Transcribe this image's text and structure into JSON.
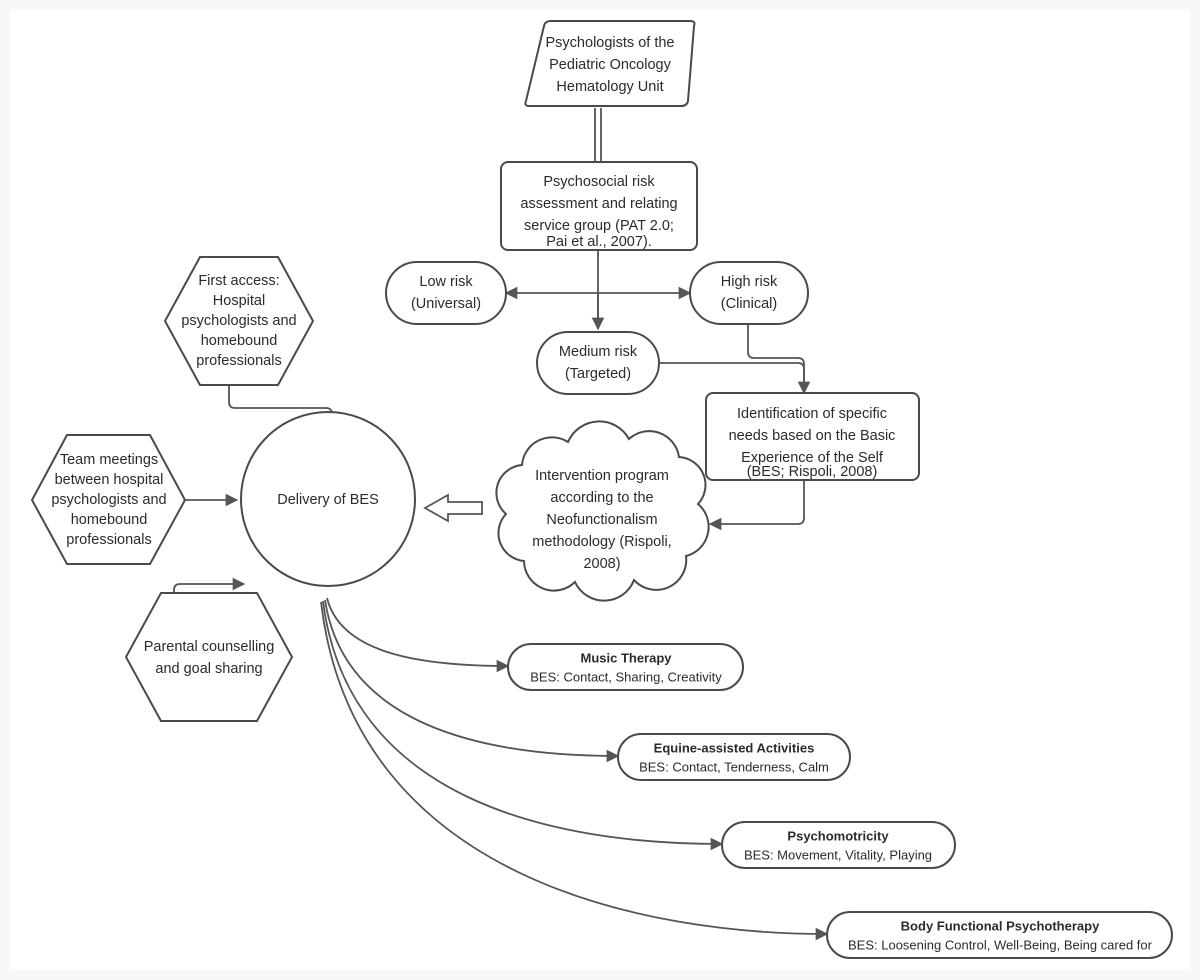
{
  "diagram": {
    "title": "Psychological intervention flow for Pediatric Oncology Hematology Unit",
    "background_color": "#f7f8fa",
    "canvas_color": "#ffffff",
    "stroke_color": "#4a4a4a",
    "edge_color": "#555555"
  },
  "nodes": {
    "source": {
      "shape": "lean-right-parallelogram",
      "lines": [
        "Psychologists of the",
        "Pediatric Oncology",
        "Hematology Unit"
      ]
    },
    "assessment": {
      "shape": "rounded-rectangle",
      "lines": [
        "Psychosocial risk",
        "assessment and relating",
        "service group (PAT 2.0;",
        "Pai et al., 2007)."
      ]
    },
    "low_risk": {
      "shape": "stadium",
      "color": "#b7e1cd",
      "lines": [
        "Low risk",
        "(Universal)"
      ]
    },
    "medium_risk": {
      "shape": "stadium",
      "color": "#e8e23c",
      "lines": [
        "Medium risk",
        "(Targeted)"
      ]
    },
    "high_risk": {
      "shape": "stadium",
      "color": "#f4a48c",
      "lines": [
        "High risk",
        "(Clinical)"
      ]
    },
    "identification": {
      "shape": "rounded-rectangle",
      "lines": [
        "Identification of specific",
        "needs based on the Basic",
        "Experience of the Self",
        "(BES; Rispoli, 2008)"
      ]
    },
    "intervention": {
      "shape": "cloud",
      "lines": [
        "Intervention program",
        "according to the",
        "Neofunctionalism",
        "methodology (Rispoli,",
        "2008)"
      ]
    },
    "delivery": {
      "shape": "circle",
      "lines": [
        "Delivery of BES"
      ]
    },
    "first_access": {
      "shape": "hexagon",
      "lines": [
        "First access:",
        "Hospital",
        "psychologists and",
        "homebound",
        "professionals"
      ]
    },
    "team_meetings": {
      "shape": "hexagon",
      "lines": [
        "Team meetings",
        "between hospital",
        "psychologists and",
        "homebound",
        "professionals"
      ]
    },
    "parental": {
      "shape": "hexagon",
      "lines": [
        "Parental counselling",
        "and goal sharing"
      ]
    }
  },
  "therapies": [
    {
      "id": "music-therapy",
      "title": "Music Therapy",
      "subtitle": "BES: Contact, Sharing, Creativity"
    },
    {
      "id": "equine-assisted-activities",
      "title": "Equine-assisted Activities",
      "subtitle": "BES: Contact, Tenderness, Calm"
    },
    {
      "id": "psychomotricity",
      "title": "Psychomotricity",
      "subtitle": "BES: Movement, Vitality, Playing"
    },
    {
      "id": "body-functional-psychotherapy",
      "title": "Body Functional Psychotherapy",
      "subtitle": "BES: Loosening Control, Well-Being, Being cared for"
    }
  ],
  "chart_data": {
    "type": "diagram",
    "title": "Psychological intervention flow for Pediatric Oncology Hematology Unit",
    "edges": [
      {
        "from": "source",
        "to": "assessment",
        "style": "double-line"
      },
      {
        "from": "assessment",
        "to": "low_risk",
        "style": "arrow"
      },
      {
        "from": "assessment",
        "to": "medium_risk",
        "style": "arrow"
      },
      {
        "from": "assessment",
        "to": "high_risk",
        "style": "arrow"
      },
      {
        "from": "high_risk",
        "to": "identification",
        "style": "arrow"
      },
      {
        "from": "medium_risk",
        "to": "identification",
        "style": "arrow"
      },
      {
        "from": "identification",
        "to": "intervention",
        "style": "arrow"
      },
      {
        "from": "intervention",
        "to": "delivery",
        "style": "thick-hollow-arrow"
      },
      {
        "from": "first_access",
        "to": "delivery",
        "style": "arrow"
      },
      {
        "from": "team_meetings",
        "to": "delivery",
        "style": "arrow"
      },
      {
        "from": "parental",
        "to": "delivery",
        "style": "arrow"
      },
      {
        "from": "delivery",
        "to": "music-therapy",
        "style": "curved-arrow"
      },
      {
        "from": "delivery",
        "to": "equine-assisted-activities",
        "style": "curved-arrow"
      },
      {
        "from": "delivery",
        "to": "psychomotricity",
        "style": "curved-arrow"
      },
      {
        "from": "delivery",
        "to": "body-functional-psychotherapy",
        "style": "curved-arrow"
      }
    ]
  }
}
